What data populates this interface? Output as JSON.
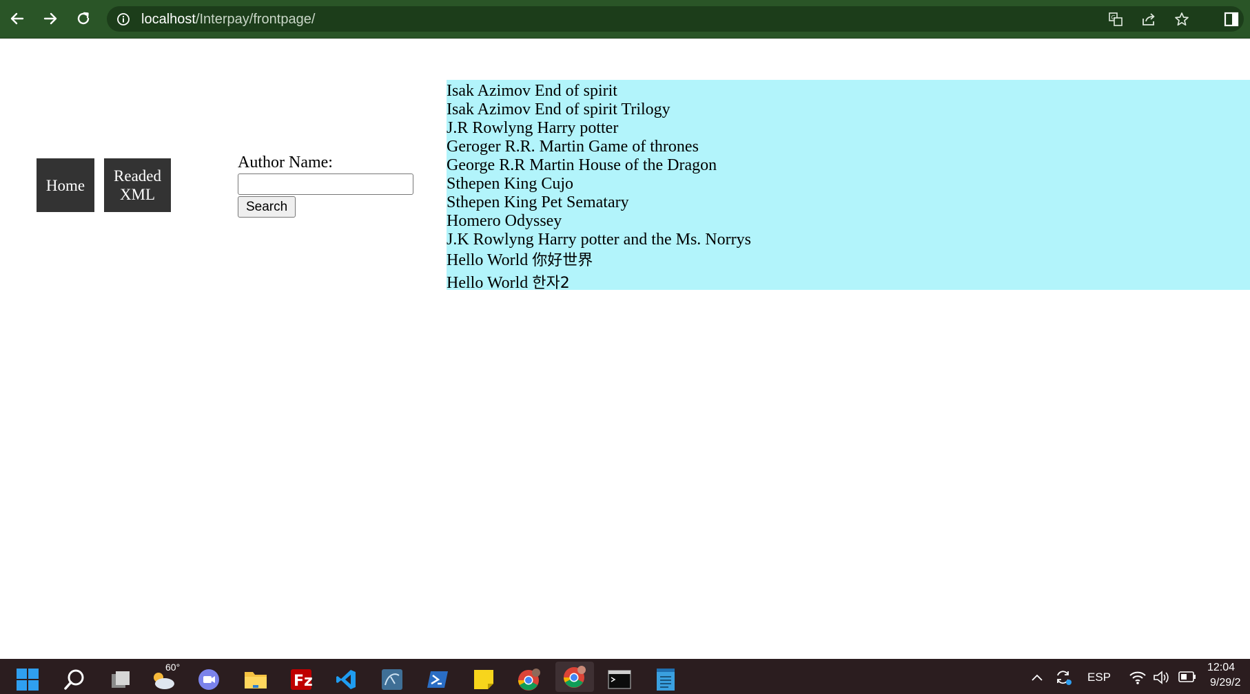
{
  "browser": {
    "url_host": "localhost",
    "url_path": "/Interpay/frontpage/"
  },
  "nav": {
    "home_label": "Home",
    "readed_line1": "Readed",
    "readed_line2": "XML"
  },
  "search": {
    "label": "Author Name:",
    "value": "",
    "placeholder": "",
    "button_label": "Search"
  },
  "books": [
    "Isak Azimov End of spirit",
    "Isak Azimov End of spirit Trilogy",
    "J.R Rowlyng Harry potter",
    "Geroger R.R. Martin Game of thrones",
    "George R.R Martin House of the Dragon",
    "Sthepen King Cujo",
    "Sthepen King Pet Sematary",
    "Homero Odyssey",
    "J.K Rowlyng Harry potter and the Ms. Norrys"
  ],
  "books_cjk": [
    {
      "latin": "Hello World ",
      "cjk": "你好世界"
    },
    {
      "latin": "Hello World ",
      "cjk": "한자2"
    }
  ],
  "colors": {
    "chrome_bg": "#2a5527",
    "list_bg": "#b2f4fb",
    "menu_bg": "#333333",
    "taskbar_bg": "#2b1d1f"
  },
  "taskbar": {
    "weather_temp": "60°",
    "language": "ESP",
    "time": "12:04",
    "date": "9/29/2"
  }
}
